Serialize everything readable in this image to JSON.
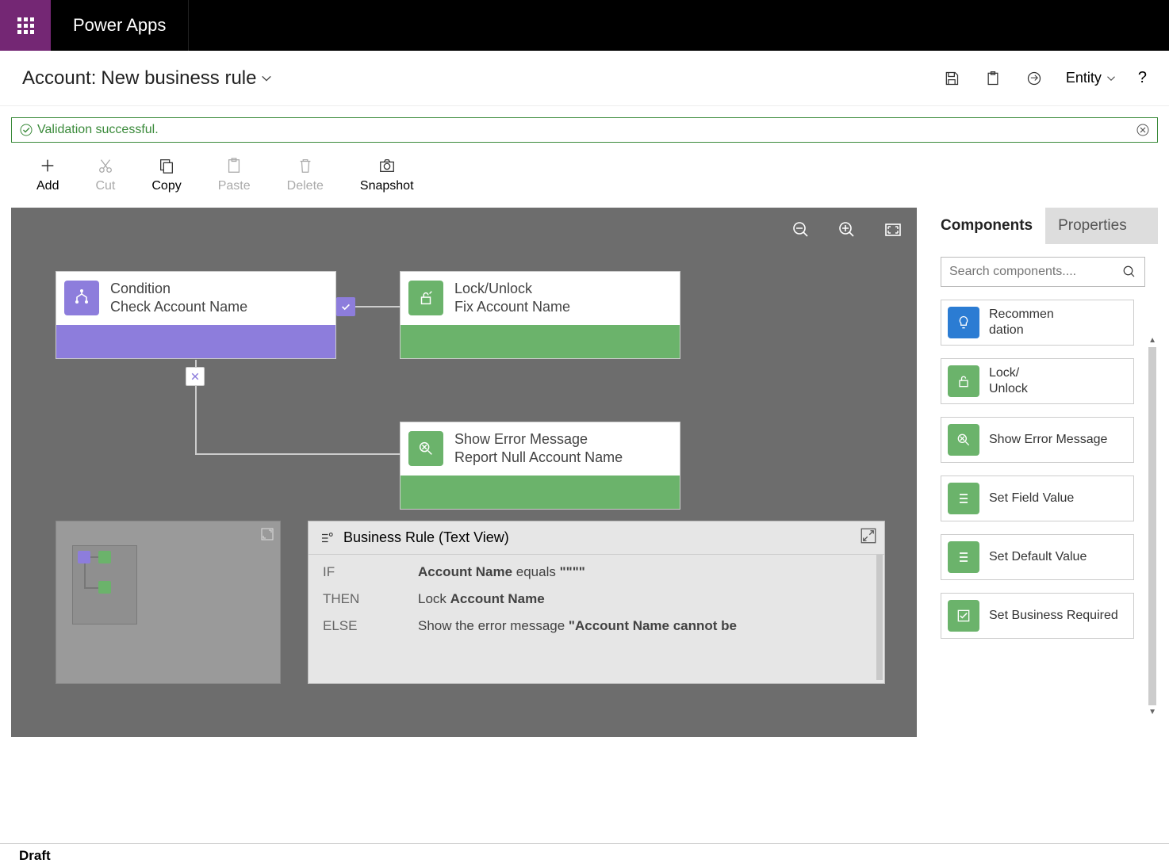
{
  "brand": "Power Apps",
  "header": {
    "title_prefix": "Account:",
    "title_body": "New business rule",
    "scope_label": "Entity"
  },
  "validation": {
    "message": "Validation successful."
  },
  "toolbar": {
    "add": "Add",
    "cut": "Cut",
    "copy": "Copy",
    "paste": "Paste",
    "delete": "Delete",
    "snapshot": "Snapshot"
  },
  "nodes": {
    "condition": {
      "type": "Condition",
      "name": "Check Account Name"
    },
    "lock": {
      "type": "Lock/Unlock",
      "name": "Fix Account Name"
    },
    "error": {
      "type": "Show Error Message",
      "name": "Report Null Account Name"
    }
  },
  "textview": {
    "title": "Business Rule (Text View)",
    "if_kw": "IF",
    "then_kw": "THEN",
    "else_kw": "ELSE",
    "if_field": "Account Name",
    "if_op": " equals ",
    "if_val": "\"\"\"\"",
    "then_pre": "Lock ",
    "then_field": "Account Name",
    "else_pre": "Show the error message ",
    "else_msg": "\"Account Name cannot be"
  },
  "panel": {
    "tabs": {
      "components": "Components",
      "properties": "Properties"
    },
    "search_placeholder": "Search components....",
    "items": {
      "recommendation": "Recommendation",
      "lock": "Lock/\nUnlock",
      "error": "Show Error Message",
      "setfield": "Set Field Value",
      "setdefault": "Set Default Value",
      "required": "Set Business Required"
    }
  },
  "status": "Draft"
}
